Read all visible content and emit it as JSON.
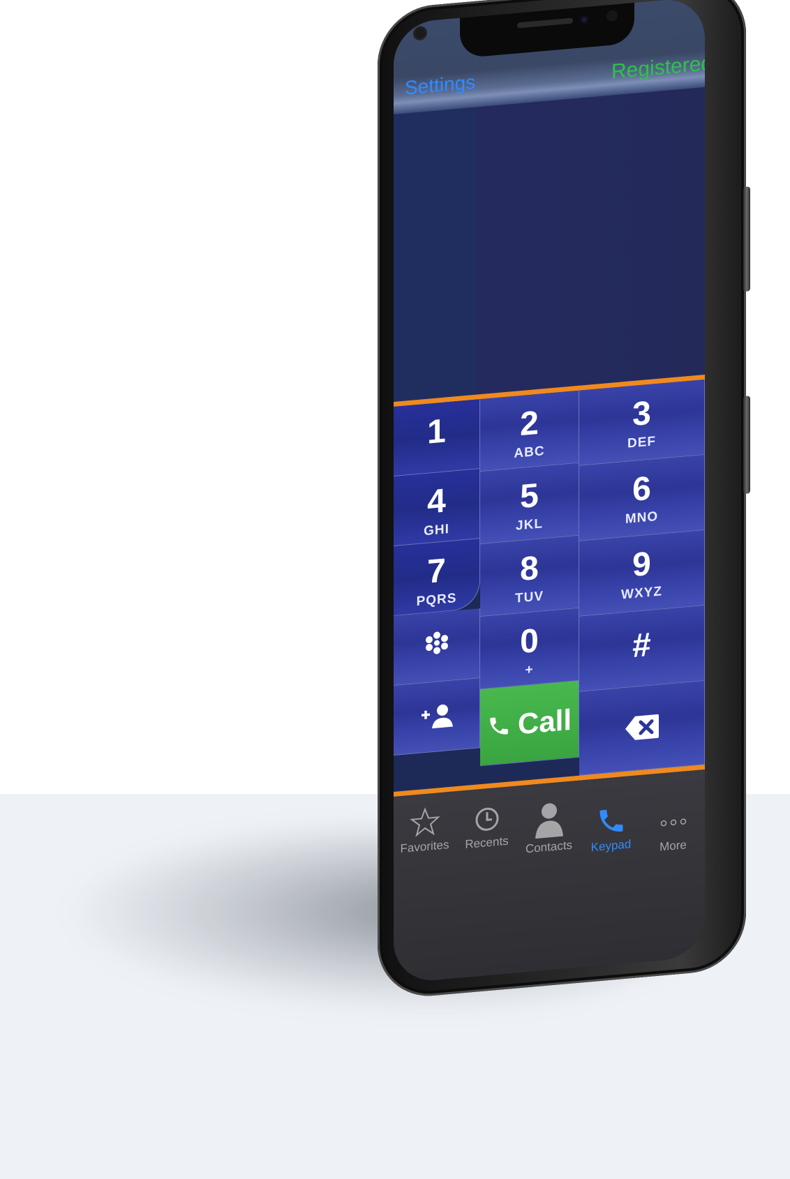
{
  "header": {
    "settings_label": "Settings",
    "status_label": "Registered"
  },
  "keypad": {
    "keys": [
      {
        "digit": "1",
        "letters": ""
      },
      {
        "digit": "2",
        "letters": "ABC"
      },
      {
        "digit": "3",
        "letters": "DEF"
      },
      {
        "digit": "4",
        "letters": "GHI"
      },
      {
        "digit": "5",
        "letters": "JKL"
      },
      {
        "digit": "6",
        "letters": "MNO"
      },
      {
        "digit": "7",
        "letters": "PQRS"
      },
      {
        "digit": "8",
        "letters": "TUV"
      },
      {
        "digit": "9",
        "letters": "WXYZ"
      },
      {
        "digit": "",
        "letters": ""
      },
      {
        "digit": "0",
        "letters": "+"
      },
      {
        "digit": "#",
        "letters": ""
      }
    ],
    "call_label": "Call"
  },
  "tabbar": {
    "items": [
      {
        "label": "Favorites"
      },
      {
        "label": "Recents"
      },
      {
        "label": "Contacts"
      },
      {
        "label": "Keypad"
      },
      {
        "label": "More"
      }
    ]
  },
  "colors": {
    "accent": "#2f8cff",
    "status": "#2ec24a",
    "divider": "#f08a1e",
    "call": "#3aa540"
  }
}
